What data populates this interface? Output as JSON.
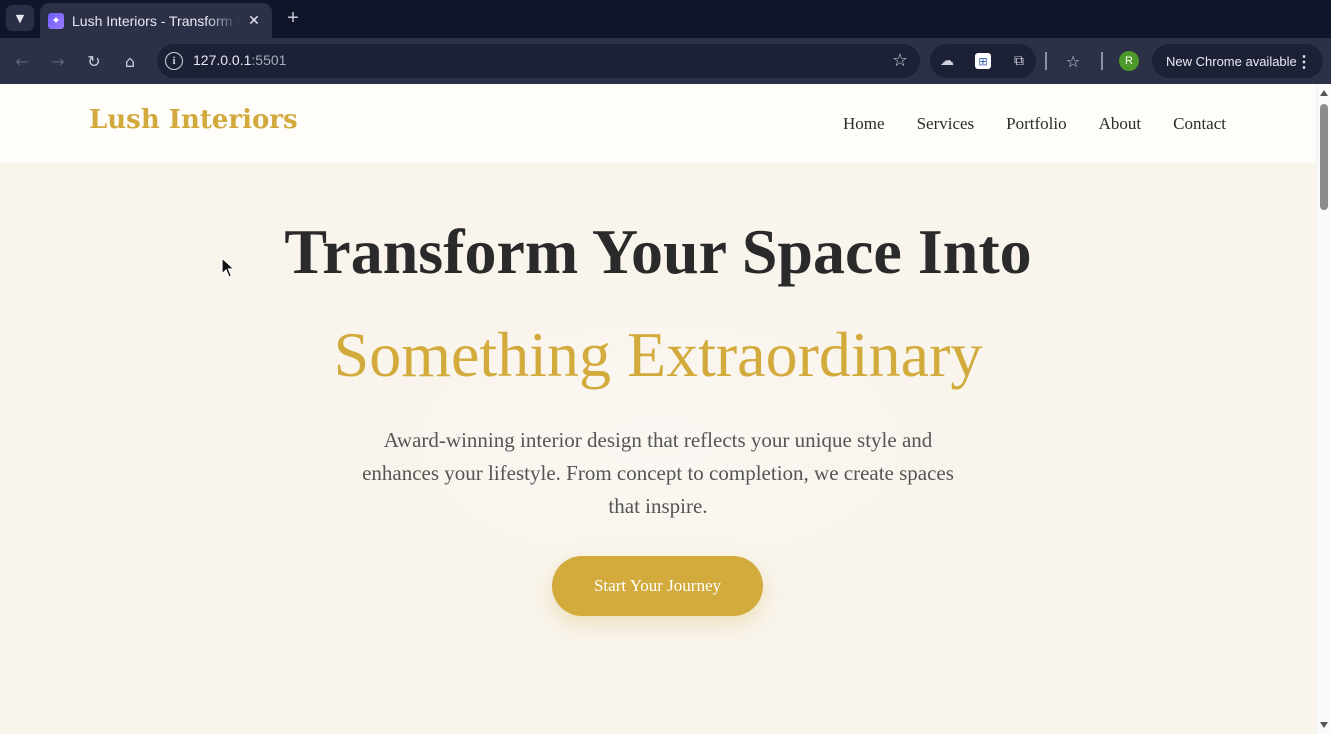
{
  "browser": {
    "tab": {
      "title": "Lush Interiors - Transform Your Space",
      "close": "✕"
    },
    "new_tab": "+",
    "url_host": "127.0.0.1",
    "url_port": ":5501",
    "profile_initial": "R",
    "update_label": "New Chrome available"
  },
  "site": {
    "logo": "Lush Interiors",
    "nav": [
      "Home",
      "Services",
      "Portfolio",
      "About",
      "Contact"
    ]
  },
  "hero": {
    "line1": "Transform Your Space Into",
    "line2": "Something Extraordinary",
    "description": "Award-winning interior design that reflects your unique style and enhances your lifestyle. From concept to completion, we create spaces that inspire.",
    "cta": "Start Your Journey"
  },
  "colors": {
    "accent": "#d2ab3c",
    "hero_bg": "#f9f4ec",
    "text_dark": "#2a2a2a"
  }
}
